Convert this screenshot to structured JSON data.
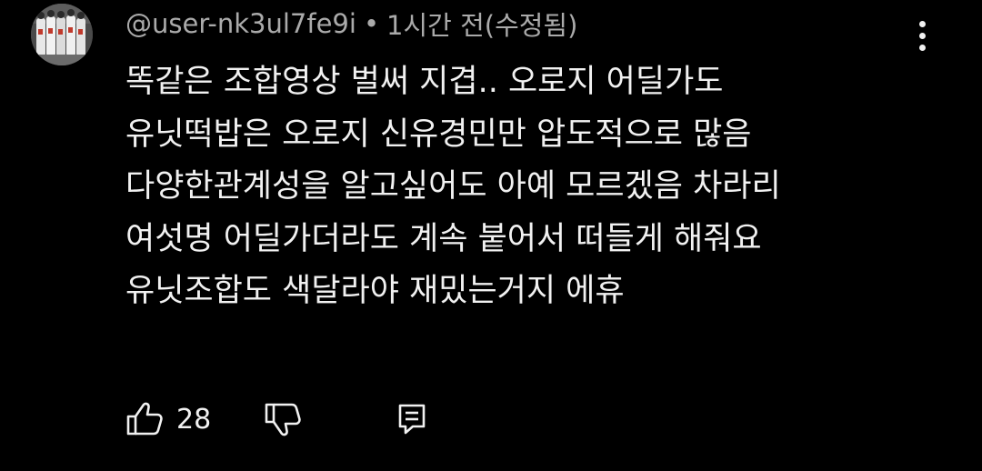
{
  "comment": {
    "author": "@user-nk3ul7fe9i",
    "separator": "•",
    "timestamp": "1시간 전(수정됨)",
    "lines": [
      "똑같은 조합영상 벌써 지겹.. 오로지 어딜가도",
      "유닛떡밥은 오로지 신유경민만 압도적으로 많음",
      "다양한관계성을 알고싶어도 아예 모르겠음 차라리",
      "여섯명 어딜가더라도 계속 붙어서 떠들게 해줘요",
      "유닛조합도 색달라야 재밌는거지 에휴"
    ],
    "like_count": "28"
  },
  "icons": {
    "avatar": "avatar-image",
    "more": "more-vert-icon",
    "like": "thumb-up-icon",
    "dislike": "thumb-down-icon",
    "reply": "comment-reply-icon"
  },
  "colors": {
    "background": "#000000",
    "text_primary": "#f1f1f1",
    "text_secondary": "#aaaaaa"
  }
}
